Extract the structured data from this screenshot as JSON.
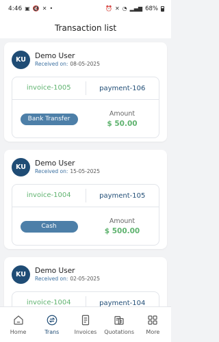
{
  "status_bar": {
    "time": "4:46",
    "battery": "68%"
  },
  "header": {
    "title": "Transaction list"
  },
  "transactions": [
    {
      "initials": "KU",
      "name": "Demo User",
      "received_label": "Received on:",
      "received_date": "08-05-2025",
      "invoice": "invoice-1005",
      "payment": "payment-106",
      "method": "Bank Transfer",
      "amount_label": "Amount",
      "amount": "$ 50.00"
    },
    {
      "initials": "KU",
      "name": "Demo User",
      "received_label": "Received on:",
      "received_date": "15-05-2025",
      "invoice": "invoice-1004",
      "payment": "payment-105",
      "method": "Cash",
      "amount_label": "Amount",
      "amount": "$ 500.00"
    },
    {
      "initials": "KU",
      "name": "Demo User",
      "received_label": "Received on:",
      "received_date": "02-05-2025",
      "invoice": "invoice-1004",
      "payment": "payment-104",
      "method": "",
      "amount_label": "",
      "amount": ""
    }
  ],
  "nav": {
    "items": [
      {
        "label": "Home",
        "icon": "home-icon",
        "active": false
      },
      {
        "label": "Trans",
        "icon": "transactions-icon",
        "active": true
      },
      {
        "label": "Invoices",
        "icon": "invoice-icon",
        "active": false
      },
      {
        "label": "Quotations",
        "icon": "quotation-icon",
        "active": false
      },
      {
        "label": "More",
        "icon": "grid-icon",
        "active": false
      }
    ]
  },
  "colors": {
    "primary": "#1f4c75",
    "accent_green": "#5fb36f",
    "method_pill": "#4d7fa8"
  }
}
